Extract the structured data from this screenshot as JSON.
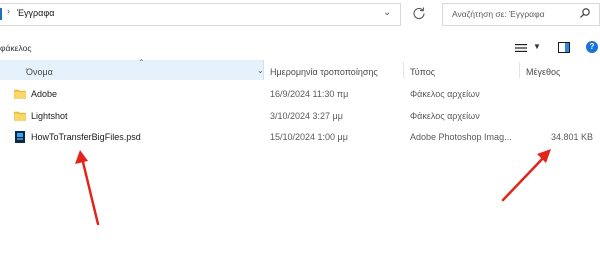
{
  "address_bar": {
    "path": "Έγγραφα",
    "separator": "›"
  },
  "search": {
    "placeholder": "Αναζήτηση σε: Έγγραφα"
  },
  "section": {
    "label": "φάκελος"
  },
  "columns": {
    "name": "Όνομα",
    "date_modified": "Ημερομηνία τροποποίησης",
    "type": "Τύπος",
    "size": "Μέγεθος"
  },
  "rows": [
    {
      "name": "Adobe",
      "date": "16/9/2024 11:30 πμ",
      "type": "Φάκελος αρχείων",
      "size": "",
      "icon": "folder-icon"
    },
    {
      "name": "Lightshot",
      "date": "3/10/2024 3:27 μμ",
      "type": "Φάκελος αρχείων",
      "size": "",
      "icon": "folder-icon"
    },
    {
      "name": "HowToTransferBigFiles.psd",
      "date": "15/10/2024 1:00 μμ",
      "type": "Adobe Photoshop Imag...",
      "size": "34.801 KB",
      "icon": "psd-file-icon"
    }
  ],
  "colors": {
    "accent": "#1a73d9",
    "header_selected": "#e5f1fb",
    "folder": "#f3c74e",
    "annotation_arrow": "#e3241b"
  }
}
